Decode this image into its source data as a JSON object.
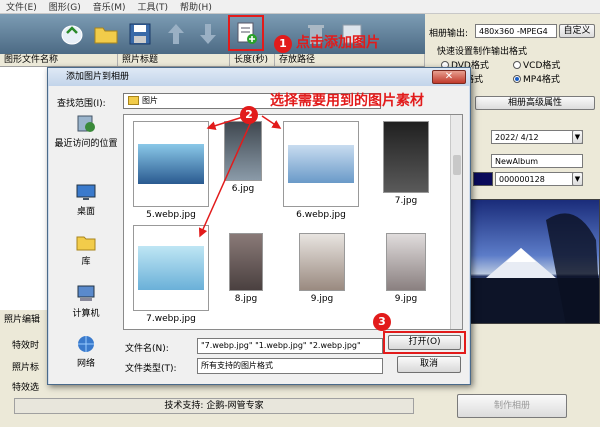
{
  "menu": [
    "文件(E)",
    "图形(G)",
    "音乐(M)",
    "工具(T)",
    "帮助(H)"
  ],
  "left_headers": [
    "图形文件名称",
    "照片标题",
    "长度(秒)",
    "存放路径"
  ],
  "callouts": {
    "c1_num": "1",
    "c1_text": "点击添加图片",
    "c2_num": "2",
    "c2_text": "选择需要用到的图片素材",
    "c3_num": "3"
  },
  "right": {
    "output_label": "相册输出:",
    "output_value": "480x360 -MPEG4",
    "custom_btn": "自定义",
    "quick_label": "快速设置制作输出格式",
    "dvd": "DVD格式",
    "vcd": "VCD格式",
    "fmt_cut": "格式",
    "mp4": "MP4格式",
    "adv_btn": "相册高级属性",
    "date": "2022/ 4/12",
    "album_name": "NewAlbum",
    "color_value": "000000128",
    "make_btn": "制作相册"
  },
  "left_bottom": {
    "photo_edit": "照片编辑",
    "l1": "特效时",
    "l2": "照片标",
    "l3": "特效选",
    "support": "技术支持: 企鹅-网管专家"
  },
  "dialog": {
    "title": "添加图片到相册",
    "lookin_label": "查找范围(I):",
    "lookin_value": "图片",
    "places": [
      {
        "label": "最近访问的位置",
        "icon": "recent-icon"
      },
      {
        "label": "桌面",
        "icon": "desktop-icon"
      },
      {
        "label": "库",
        "icon": "library-icon"
      },
      {
        "label": "计算机",
        "icon": "computer-icon"
      },
      {
        "label": "网络",
        "icon": "network-icon"
      }
    ],
    "files": [
      {
        "name": "5.webp.jpg"
      },
      {
        "name": "6.jpg"
      },
      {
        "name": "6.webp.jpg"
      },
      {
        "name": "7.jpg"
      },
      {
        "name": "7.webp.jpg"
      },
      {
        "name": "8.jpg"
      },
      {
        "name": "9.jpg"
      },
      {
        "name": "9.jpg"
      }
    ],
    "filename_label": "文件名(N):",
    "filename_value": "\"7.webp.jpg\" \"1.webp.jpg\" \"2.webp.jpg\"",
    "filetype_label": "文件类型(T):",
    "filetype_value": "所有支持的图片格式",
    "open_btn": "打开(O)",
    "cancel_btn": "取消"
  },
  "colors": {
    "highlight": "#e21b1b",
    "toolbar": "#5a7a94"
  }
}
